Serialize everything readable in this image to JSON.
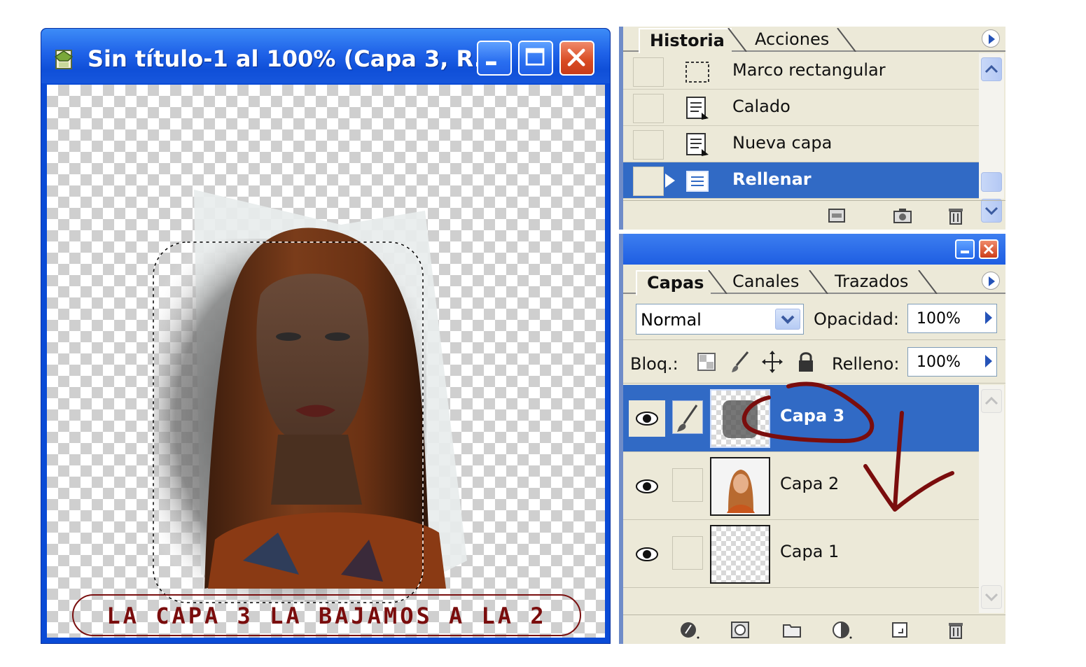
{
  "document_window": {
    "title": "Sin título-1 al 100% (Capa 3, R...",
    "caption": "LA CAPA 3 LA BAJAMOS A LA 2"
  },
  "history_panel": {
    "tabs": [
      {
        "label": "Historia",
        "active": true
      },
      {
        "label": "Acciones",
        "active": false
      }
    ],
    "items": [
      {
        "label": "Marco rectangular",
        "icon": "marquee-icon"
      },
      {
        "label": "Calado",
        "icon": "history-state-icon"
      },
      {
        "label": "Nueva capa",
        "icon": "history-state-icon"
      },
      {
        "label": "Rellenar",
        "icon": "history-state-icon",
        "selected": true
      }
    ]
  },
  "layers_panel": {
    "tabs": [
      {
        "label": "Capas",
        "active": true
      },
      {
        "label": "Canales",
        "active": false
      },
      {
        "label": "Trazados",
        "active": false
      }
    ],
    "blend_mode": "Normal",
    "opacity_label": "Opacidad:",
    "opacity_value": "100%",
    "lock_label": "Bloq.:",
    "fill_label": "Relleno:",
    "fill_value": "100%",
    "layers": [
      {
        "name": "Capa 3",
        "selected": true,
        "visible": true
      },
      {
        "name": "Capa 2",
        "selected": false,
        "visible": true
      },
      {
        "name": "Capa 1",
        "selected": false,
        "visible": true
      }
    ]
  },
  "colors": {
    "selection_blue": "#316ac5",
    "panel_bg": "#ece9d8",
    "annotation_red": "#7a0d0d",
    "titlebar_blue": "#1f62e8"
  }
}
